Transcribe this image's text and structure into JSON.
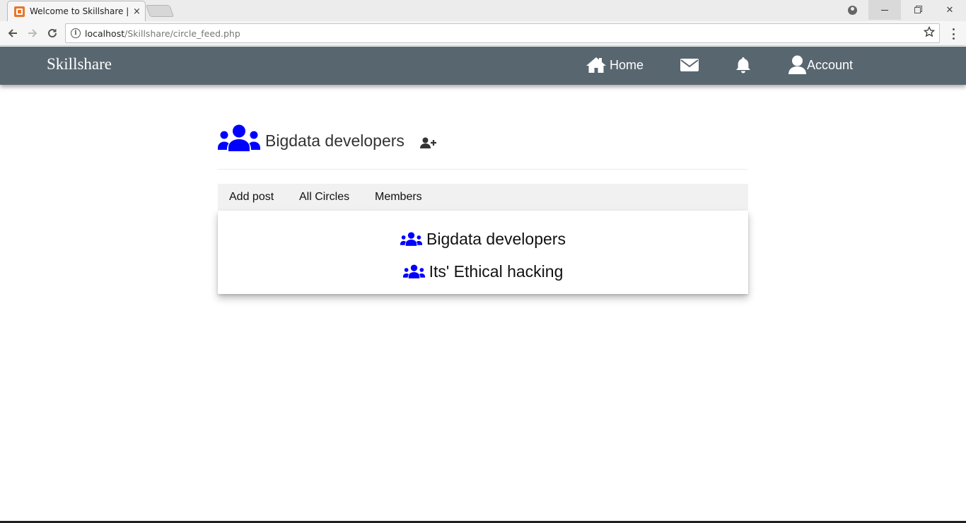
{
  "browser": {
    "tab_title": "Welcome to Skillshare | B",
    "tab_close": "×",
    "url_host": "localhost",
    "url_path": "/Skillshare/circle_feed.php",
    "win_close": "✕"
  },
  "header": {
    "brand": "Skillshare",
    "nav": {
      "home": "Home",
      "account": "Account"
    }
  },
  "circle": {
    "name": "Bigdata developers"
  },
  "tabs": {
    "add_post": "Add post",
    "all_circles": "All Circles",
    "members": "Members"
  },
  "circles_list": [
    {
      "name": "Bigdata developers"
    },
    {
      "name": "Its' Ethical hacking"
    }
  ],
  "colors": {
    "header_bg": "#58666f",
    "icon_blue": "#0000ff",
    "tabs_bg": "#f1f1f1"
  },
  "icons": {
    "group": "users-icon",
    "add_member": "user-plus-icon",
    "home": "home-icon",
    "mail": "envelope-icon",
    "notifications": "bell-icon",
    "account": "user-icon"
  }
}
